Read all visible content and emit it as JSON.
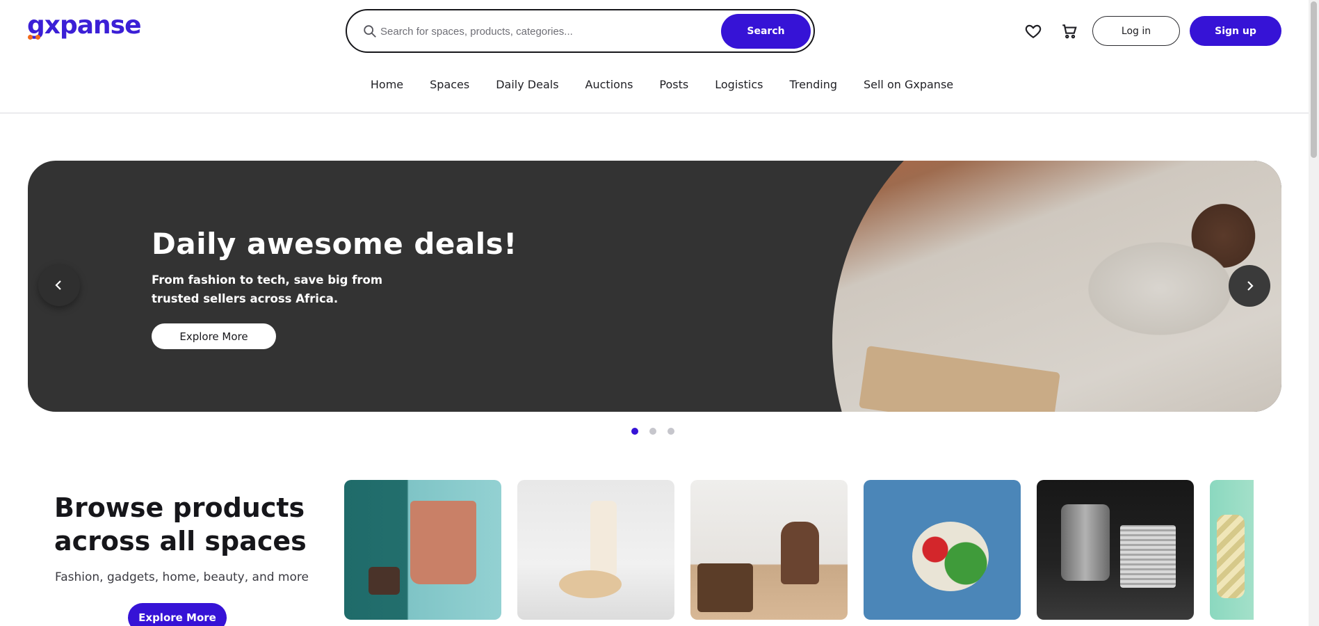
{
  "header": {
    "logo_text": "gxpanse",
    "search": {
      "placeholder": "Search for spaces, products, categories...",
      "value": "",
      "button_label": "Search"
    },
    "icons": [
      "heart-icon",
      "cart-icon"
    ],
    "login_label": "Log in",
    "signup_label": "Sign up"
  },
  "nav": {
    "items": [
      {
        "label": "Home"
      },
      {
        "label": "Spaces"
      },
      {
        "label": "Daily Deals"
      },
      {
        "label": "Auctions"
      },
      {
        "label": "Posts"
      },
      {
        "label": "Logistics"
      },
      {
        "label": "Trending"
      },
      {
        "label": "Sell on Gxpanse"
      }
    ]
  },
  "hero": {
    "title": "Daily awesome deals!",
    "subtitle": "From fashion to tech, save big from trusted sellers across Africa.",
    "button_label": "Explore More",
    "slide_count": 3,
    "active_slide": 1
  },
  "browse": {
    "title": "Browse products across all spaces",
    "subtitle": "Fashion, gadgets, home, beauty, and more",
    "button_label": "Explore More",
    "tiles": [
      "fashion-tile",
      "beauty-tile",
      "home-tile",
      "groceries-tile",
      "auto-parts-tile",
      "toys-tile"
    ]
  },
  "colors": {
    "brand": "#3613d6",
    "accent": "#f26a1b",
    "hero_bg": "#333333"
  }
}
